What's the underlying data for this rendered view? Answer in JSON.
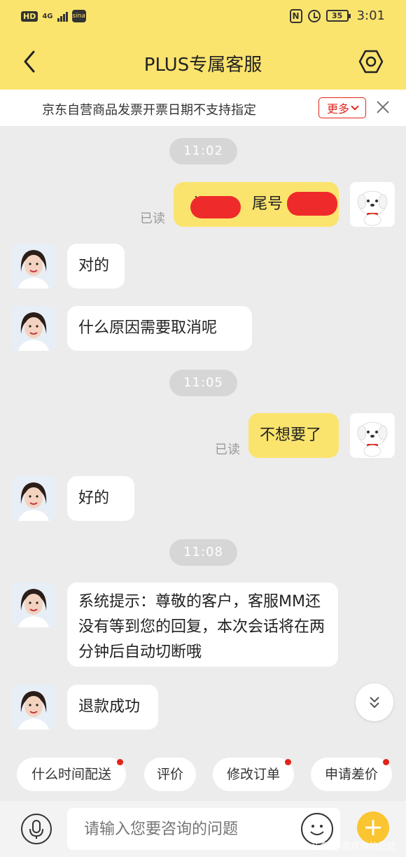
{
  "status_bar": {
    "hd_label": "HD",
    "network": "4G",
    "weibo": "sina",
    "nfc": "N",
    "battery": "35",
    "time": "3:01"
  },
  "nav": {
    "title": "PLUS专属客服"
  },
  "notice": {
    "text": "京东自营商品发票开票日期不支持指定",
    "more_label": "更多"
  },
  "chat": {
    "times": [
      "11:02",
      "11:05",
      "11:08"
    ],
    "read_label": "已读",
    "messages": {
      "m1_prefix": "订",
      "m1_mid": "尾号",
      "m2": "对的",
      "m3": "什么原因需要取消呢",
      "m4": "不想要了",
      "m5": "好的",
      "m6": "系统提示：尊敬的客户，客服MM还没有等到您的回复，本次会话将在两分钟后自动切断哦",
      "m7": "退款成功"
    }
  },
  "quick_replies": [
    {
      "label": "什么时间配送",
      "badge": true
    },
    {
      "label": "评价",
      "badge": false
    },
    {
      "label": "修改订单",
      "badge": true
    },
    {
      "label": "申请差价",
      "badge": true
    }
  ],
  "input": {
    "placeholder": "请输入您要咨询的问题"
  },
  "watermark": "头条 @喜欢你的记忆",
  "colors": {
    "header": "#fbe46e",
    "accent_red": "#e2231a",
    "bubble_self": "#fbe46e",
    "plus_button": "#fbc531"
  }
}
